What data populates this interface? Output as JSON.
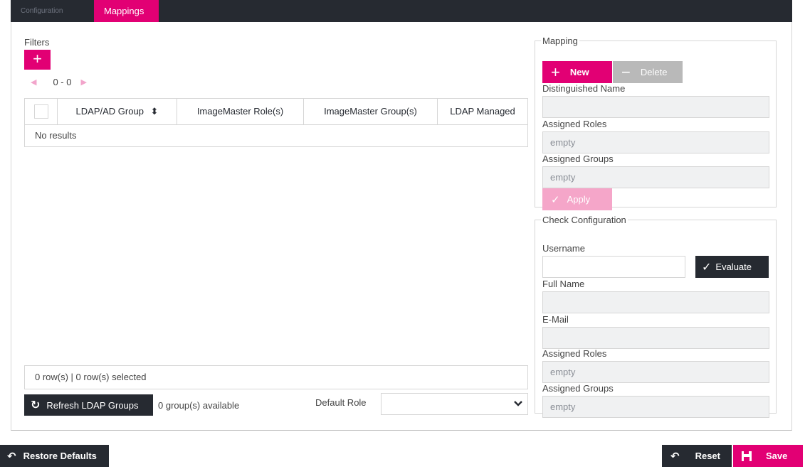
{
  "tabs": {
    "configuration": "Configuration",
    "mappings": "Mappings"
  },
  "filters": {
    "label": "Filters",
    "add_icon": "plus-icon",
    "pager_range": "0 - 0"
  },
  "grid": {
    "columns": [
      "LDAP/AD Group",
      "ImageMaster Role(s)",
      "ImageMaster Group(s)",
      "LDAP Managed"
    ],
    "sort_icon": "sort-icon",
    "no_results": "No results",
    "footer": "0 row(s) | 0 row(s) selected"
  },
  "actions": {
    "refresh_label": "Refresh LDAP Groups",
    "groups_available": "0 group(s) available",
    "default_role_label": "Default Role",
    "default_role_value": ""
  },
  "mapping": {
    "legend": "Mapping",
    "new_label": "New",
    "delete_label": "Delete",
    "dn_label": "Distinguished Name",
    "dn_value": "",
    "roles_label": "Assigned Roles",
    "roles_value": "empty",
    "groups_label": "Assigned Groups",
    "groups_value": "empty",
    "apply_label": "Apply"
  },
  "check": {
    "legend": "Check Configuration",
    "username_label": "Username",
    "username_value": "",
    "evaluate_label": "Evaluate",
    "fullname_label": "Full Name",
    "fullname_value": "",
    "email_label": "E-Mail",
    "email_value": "",
    "roles_label": "Assigned Roles",
    "roles_value": "empty",
    "groups_label": "Assigned Groups",
    "groups_value": "empty"
  },
  "footer": {
    "restore_label": "Restore Defaults",
    "reset_label": "Reset",
    "save_label": "Save"
  },
  "colors": {
    "accent": "#e20074",
    "accent_disabled": "#f5a6c9",
    "dark": "#262a31",
    "disabled_gray": "#b9b9b9"
  }
}
